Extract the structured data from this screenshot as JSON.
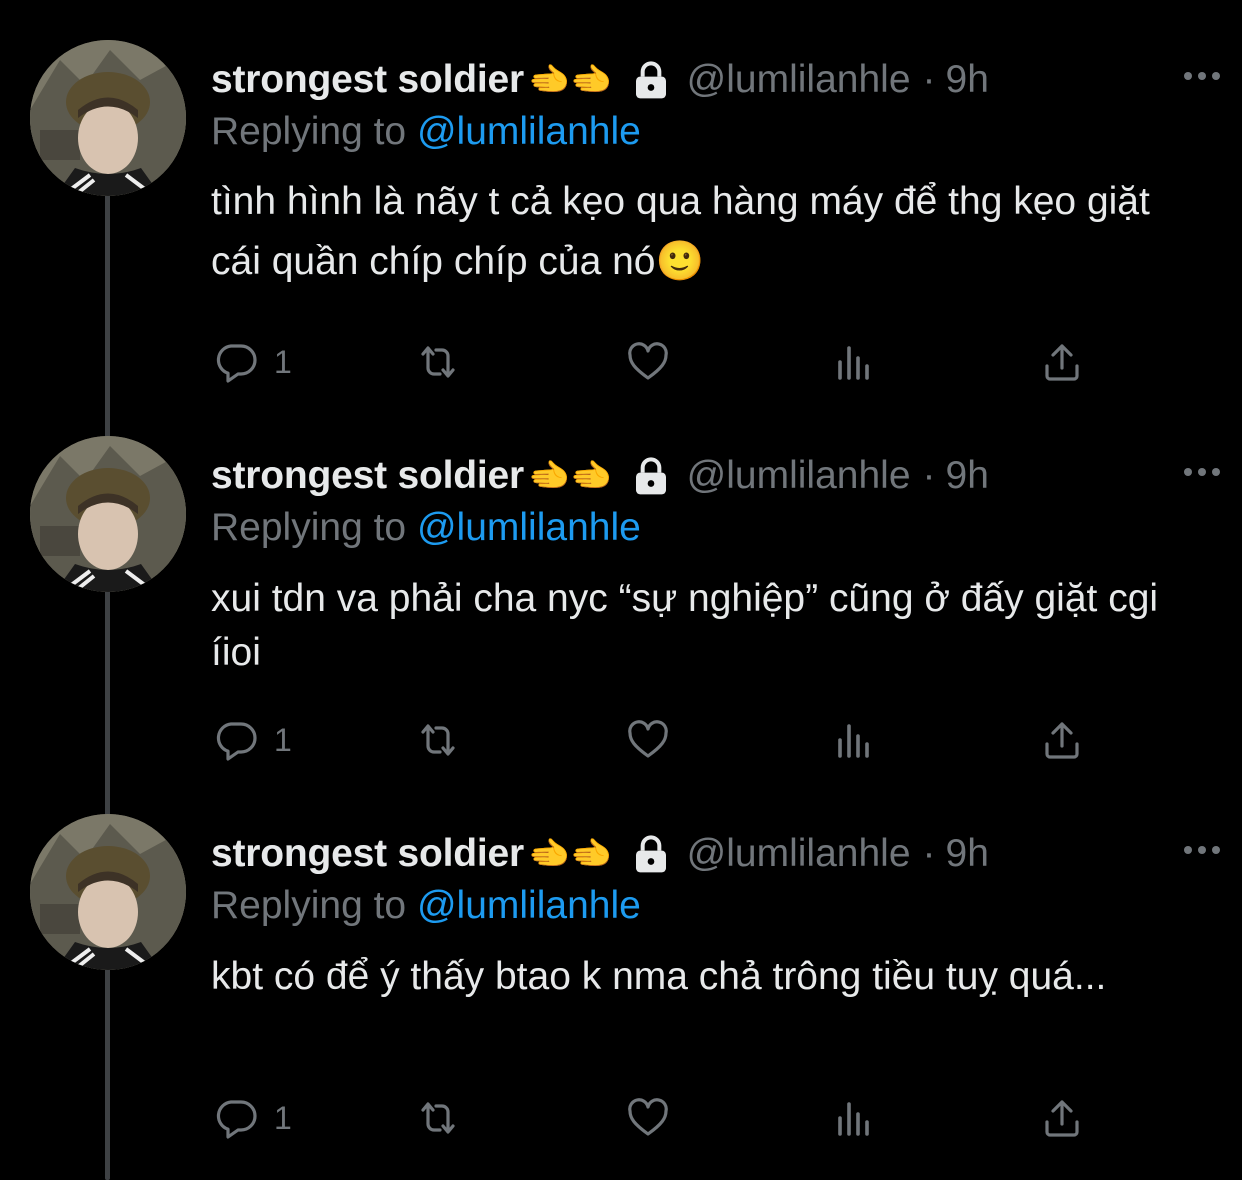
{
  "colors": {
    "background": "#000000",
    "text": "#e7e9ea",
    "muted": "#71767b",
    "mention": "#1d9bf0",
    "thread_line": "#3e4144"
  },
  "tweets": [
    {
      "name": "strongest soldier",
      "emojis": "🫲🫲",
      "handle": "@lumlilanhle",
      "dot": "·",
      "time": "9h",
      "replying_prefix": "Replying to ",
      "replying_handle": "@lumlilanhle",
      "text": "tình hình là nãy t cả kẹo qua hàng máy để thg kẹo giặt cái quần chíp chíp của nó🙂",
      "reply_count": "1",
      "icons": [
        "lock-icon",
        "more-icon",
        "reply-icon",
        "retweet-icon",
        "like-icon",
        "views-icon",
        "share-icon"
      ]
    },
    {
      "name": "strongest soldier",
      "emojis": "🫲🫲",
      "handle": "@lumlilanhle",
      "dot": "·",
      "time": "9h",
      "replying_prefix": "Replying to ",
      "replying_handle": "@lumlilanhle",
      "text": "xui tdn va phải cha nyc “sự nghiệp” cũng ở đấy giặt cgi íioi",
      "reply_count": "1"
    },
    {
      "name": "strongest soldier",
      "emojis": "🫲🫲",
      "handle": "@lumlilanhle",
      "dot": "·",
      "time": "9h",
      "replying_prefix": "Replying to ",
      "replying_handle": "@lumlilanhle",
      "text": "kbt có để ý thấy btao k nma chả trông tiều tuỵ quá...",
      "reply_count": "1"
    }
  ]
}
